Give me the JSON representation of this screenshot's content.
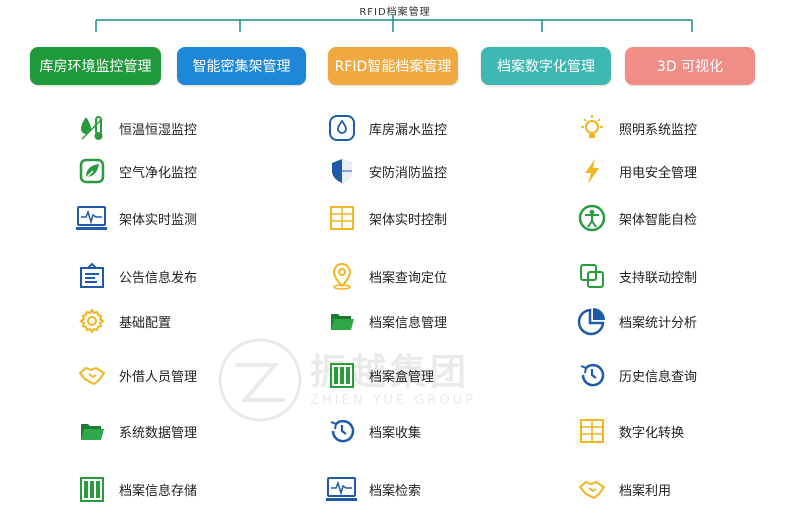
{
  "root": {
    "title": "RFID档案管理"
  },
  "colors": {
    "line": "#1a8a8a",
    "green": "#1f9a3a",
    "blue": "#1e87d6",
    "orange": "#f0a940",
    "teal": "#3db8b3",
    "pink": "#f08d87",
    "icon_green": "#2a9a3e",
    "icon_blue": "#1e5aa8",
    "icon_yellow": "#f0b521"
  },
  "categories": [
    {
      "label": "库房环境监控管理"
    },
    {
      "label": "智能密集架管理"
    },
    {
      "label": "RFID智能档案管理"
    },
    {
      "label": "档案数字化管理"
    },
    {
      "label": "3D 可视化"
    }
  ],
  "columns": [
    {
      "items": [
        {
          "label": "恒温恒湿监控",
          "icon": "temperature-humidity-icon"
        },
        {
          "label": "空气净化监控",
          "icon": "leaf-icon"
        },
        {
          "label": "架体实时监测",
          "icon": "monitor-pulse-icon"
        },
        {
          "label": "公告信息发布",
          "icon": "notice-board-icon"
        },
        {
          "label": "基础配置",
          "icon": "gear-icon"
        },
        {
          "label": "外借人员管理",
          "icon": "handshake-icon"
        },
        {
          "label": "系统数据管理",
          "icon": "folder-icon"
        },
        {
          "label": "档案信息存储",
          "icon": "binders-icon"
        }
      ]
    },
    {
      "items": [
        {
          "label": "库房漏水监控",
          "icon": "water-drop-icon"
        },
        {
          "label": "安防消防监控",
          "icon": "shield-icon"
        },
        {
          "label": "架体实时控制",
          "icon": "shelf-grid-icon"
        },
        {
          "label": "档案查询定位",
          "icon": "location-pin-icon"
        },
        {
          "label": "档案信息管理",
          "icon": "folder-icon"
        },
        {
          "label": "档案盒管理",
          "icon": "binders-icon"
        },
        {
          "label": "档案收集",
          "icon": "history-clock-icon"
        },
        {
          "label": "档案检索",
          "icon": "monitor-pulse-icon"
        }
      ]
    },
    {
      "items": [
        {
          "label": "照明系统监控",
          "icon": "light-bulb-icon"
        },
        {
          "label": "用电安全管理",
          "icon": "lightning-icon"
        },
        {
          "label": "架体智能自检",
          "icon": "person-circle-icon"
        },
        {
          "label": "支持联动控制",
          "icon": "linked-squares-icon"
        },
        {
          "label": "档案统计分析",
          "icon": "pie-chart-icon"
        },
        {
          "label": "历史信息查询",
          "icon": "history-clock-icon"
        },
        {
          "label": "数字化转换",
          "icon": "shelf-grid-icon"
        },
        {
          "label": "档案利用",
          "icon": "handshake-icon"
        }
      ]
    }
  ],
  "watermark": {
    "name": "振越集团",
    "sub": "ZHIEN YUE GROUP"
  }
}
